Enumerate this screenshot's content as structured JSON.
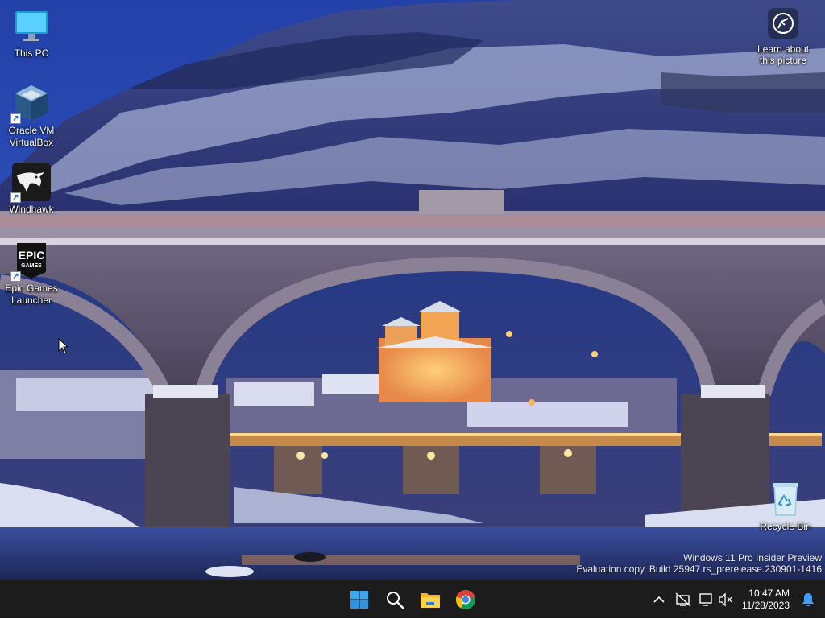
{
  "desktop": {
    "icons": [
      {
        "label": "This PC",
        "icon": "this-pc-icon"
      },
      {
        "label": "Oracle VM\nVirtualBox",
        "icon": "virtualbox-icon"
      },
      {
        "label": "Windhawk",
        "icon": "windhawk-icon"
      },
      {
        "label": "Epic Games\nLauncher",
        "icon": "epic-games-icon"
      },
      {
        "label": "Recycle Bin",
        "icon": "recycle-bin-icon"
      }
    ],
    "learn_label": "Learn about\nthis picture",
    "epic_logo_text": "EPIC GAMES"
  },
  "watermark": {
    "line1": "Windows 11 Pro Insider Preview",
    "line2": "Evaluation copy. Build 25947.rs_prerelease.230901-1416"
  },
  "taskbar": {
    "apps": [
      "start-icon",
      "search-icon",
      "file-explorer-icon",
      "chrome-icon"
    ],
    "tray": [
      "chevron-up-icon",
      "network-disconnected-icon",
      "display-volume-icon"
    ],
    "time": "10:47 AM",
    "date": "11/28/2023",
    "notification_icon": "bell-icon"
  },
  "colors": {
    "taskbar_bg": "#1c1c1c",
    "accent": "#3aa0ff",
    "sky": "#1e3c8c"
  }
}
